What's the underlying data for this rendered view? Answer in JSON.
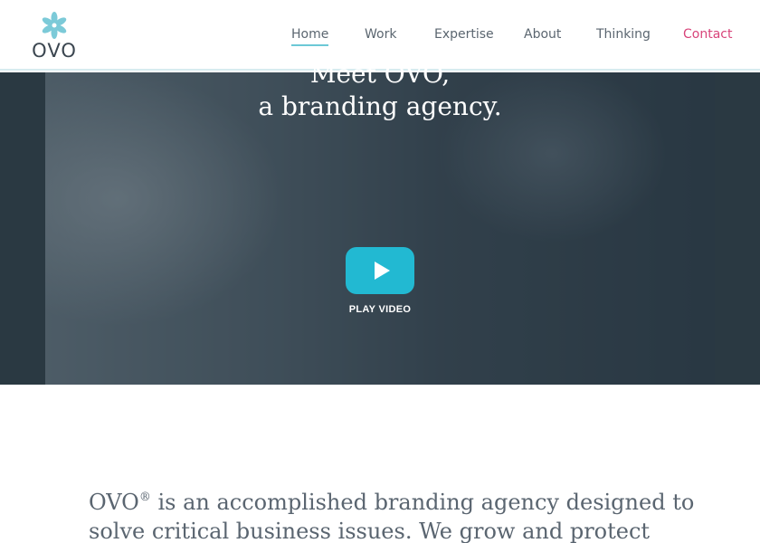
{
  "brand": {
    "name": "OVO",
    "logo_icon": "flower-icon",
    "logo_color": "#7ccad8"
  },
  "nav": {
    "items": [
      {
        "label": "Home",
        "active": true
      },
      {
        "label": "Work",
        "active": false
      },
      {
        "label": "Expertise",
        "active": false
      },
      {
        "label": "About",
        "active": false
      },
      {
        "label": "Thinking",
        "active": false
      },
      {
        "label": "Contact",
        "active": false
      }
    ],
    "active_color": "#6cc8d6",
    "contact_color": "#d8447a"
  },
  "hero": {
    "title_line1": "Meet OVO,",
    "title_line2": "a branding agency.",
    "play_label": "PLAY VIDEO",
    "play_icon": "play-icon",
    "accent_color": "#22b9d2"
  },
  "intro": {
    "brand": "OVO",
    "reg_mark": "®",
    "line1_rest": " is an accomplished branding agency designed to",
    "line2": "solve critical business issues. We grow and protect"
  }
}
